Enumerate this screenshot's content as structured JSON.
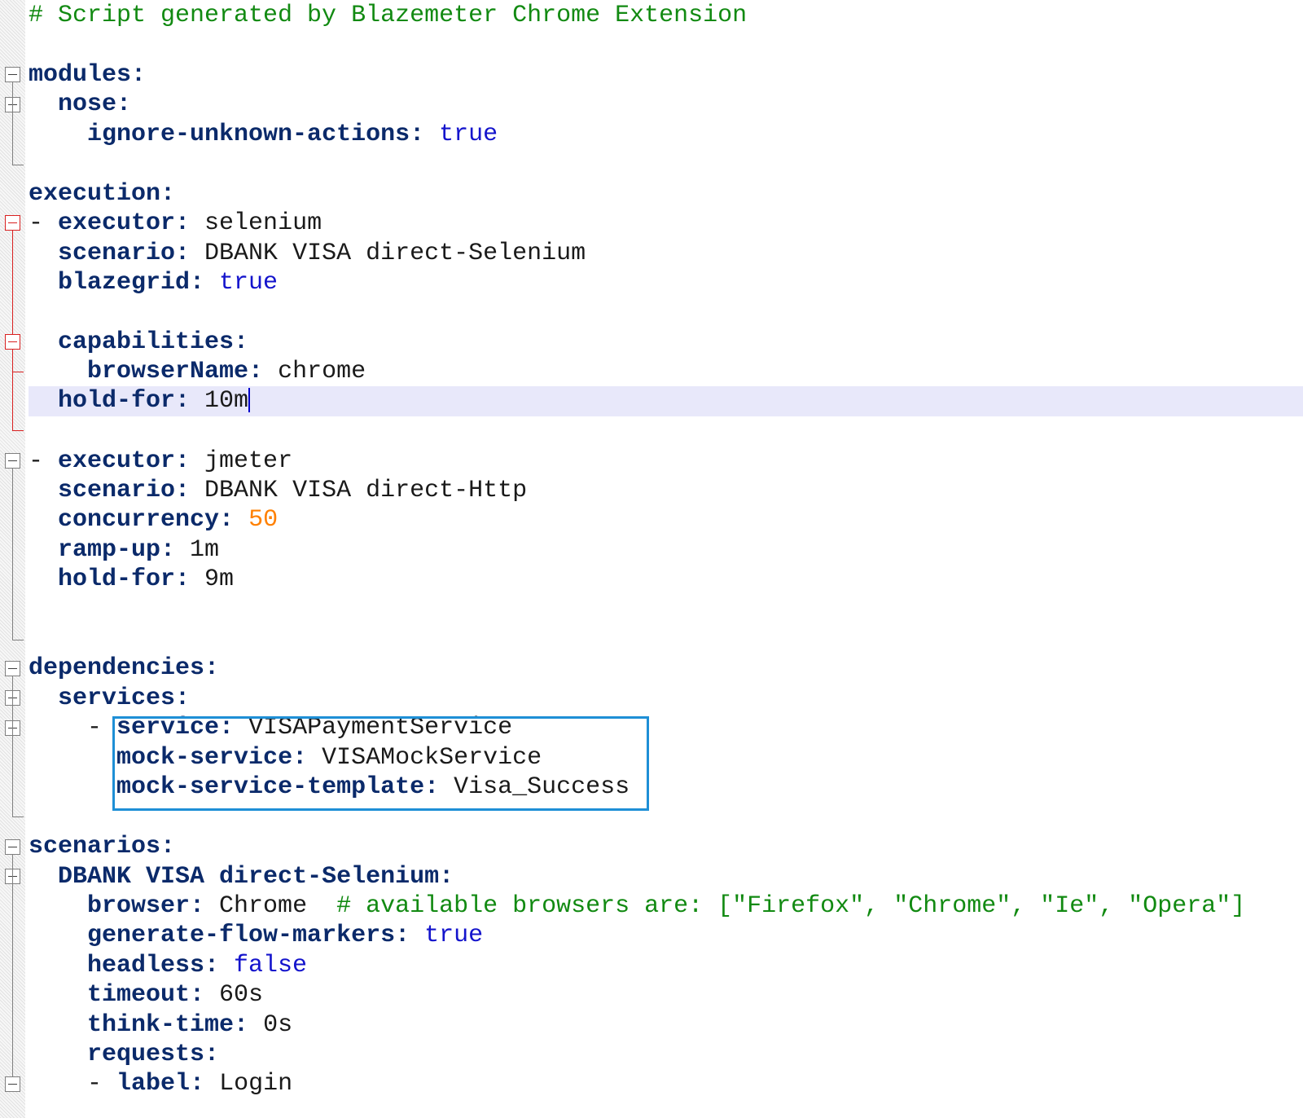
{
  "editor": {
    "language": "yaml",
    "current_line": 14,
    "colors": {
      "key": "#0b2a6a",
      "boolean": "#1414cc",
      "number": "#ff8000",
      "comment": "#128a12",
      "current_line_bg": "#e8e8fa",
      "fold_active": "#d92020",
      "highlight_box": "#1e8fd6"
    }
  },
  "lines": [
    {
      "comment": "# Script generated by Blazemeter Chrome Extension"
    },
    {
      "indent": "",
      "key": "modules:"
    },
    {
      "indent": "  ",
      "key": "nose:"
    },
    {
      "indent": "    ",
      "key": "ignore-unknown-actions:",
      "value": " true"
    },
    {
      "indent": "",
      "key": "execution:"
    },
    {
      "dash": "- ",
      "key": "executor:",
      "value": " selenium"
    },
    {
      "indent": "  ",
      "key": "scenario:",
      "value": " DBANK VISA direct-Selenium"
    },
    {
      "indent": "  ",
      "key": "blazegrid:",
      "value": " true"
    },
    {
      "indent": "  ",
      "key": "capabilities:"
    },
    {
      "indent": "    ",
      "key": "browserName:",
      "value": " chrome"
    },
    {
      "indent": "  ",
      "key": "hold-for:",
      "value": " 10m"
    },
    {
      "dash": "- ",
      "key": "executor:",
      "value": " jmeter"
    },
    {
      "indent": "  ",
      "key": "scenario:",
      "value": " DBANK VISA direct-Http"
    },
    {
      "indent": "  ",
      "key": "concurrency:",
      "value": " 50"
    },
    {
      "indent": "  ",
      "key": "ramp-up:",
      "value": " 1m"
    },
    {
      "indent": "  ",
      "key": "hold-for:",
      "value": " 9m"
    },
    {
      "indent": "",
      "key": "dependencies:"
    },
    {
      "indent": "  ",
      "key": "services:"
    },
    {
      "dash": "    - ",
      "key": "service:",
      "value": " VISAPaymentService"
    },
    {
      "indent": "      ",
      "key": "mock-service:",
      "value": " VISAMockService"
    },
    {
      "indent": "      ",
      "key": "mock-service-template:",
      "value": " Visa_Success"
    },
    {
      "indent": "",
      "key": "scenarios:"
    },
    {
      "indent": "  ",
      "key": "DBANK VISA direct-Selenium:"
    },
    {
      "indent": "    ",
      "key": "browser:",
      "value": " Chrome  ",
      "comment": "# available browsers are: [\"Firefox\", \"Chrome\", \"Ie\", \"Opera\"]"
    },
    {
      "indent": "    ",
      "key": "generate-flow-markers:",
      "value": " true"
    },
    {
      "indent": "    ",
      "key": "headless:",
      "value": " false"
    },
    {
      "indent": "    ",
      "key": "timeout:",
      "value": " 60s"
    },
    {
      "indent": "    ",
      "key": "think-time:",
      "value": " 0s"
    },
    {
      "indent": "    ",
      "key": "requests:"
    },
    {
      "dash": "    - ",
      "key": "label:",
      "value": " Login"
    }
  ]
}
